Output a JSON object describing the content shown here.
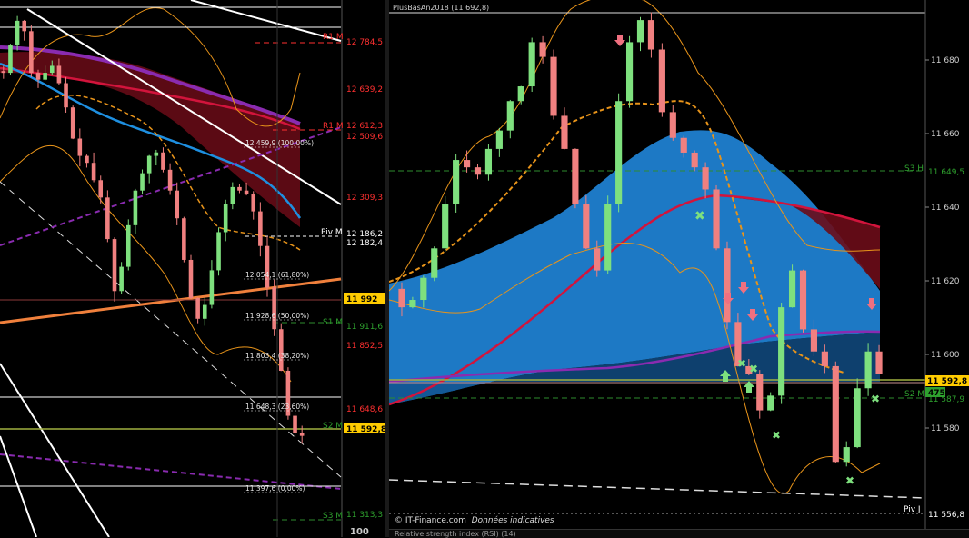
{
  "colors": {
    "background": "#000000",
    "candle_up": "#7ee07e",
    "candle_down": "#f08080",
    "fib_line": "#ffffff",
    "ma_red": "#e0123c",
    "ma_purple": "#9b2bc7",
    "band_blue": "#1e8fe0",
    "band_orange": "#e8941a",
    "trend_orange": "#f0803c",
    "pivot_green": "#2e8b2e",
    "level_red": "#ff2020",
    "price_tag": "#ffcc00"
  },
  "left_chart": {
    "axis_labels": {
      "r1": "R1 M",
      "pivm": "Piv M",
      "s1": "S1 M",
      "s2": "S2 M",
      "s3": "S3 M"
    },
    "price_tags": [
      {
        "text": "12 784,5",
        "color": "red"
      },
      {
        "text": "12 639,2",
        "color": "red"
      },
      {
        "text": "12 612,3",
        "color": "red"
      },
      {
        "text": "12 509,6",
        "color": "red"
      },
      {
        "text": "12 309,3",
        "color": "red"
      },
      {
        "text": "12 186,2",
        "color": "white"
      },
      {
        "text": "12 182,4",
        "color": "white"
      },
      {
        "text": "11 992",
        "color": "yellow"
      },
      {
        "text": "11 911,6",
        "color": "green"
      },
      {
        "text": "11 852,5",
        "color": "red"
      },
      {
        "text": "11 648,6",
        "color": "red"
      },
      {
        "text": "11 592,8",
        "color": "yellow"
      },
      {
        "text": "11 313,3",
        "color": "green"
      }
    ],
    "fib_levels": [
      "12 459,9 (100,00%)",
      "12 054,1 (61,80%)",
      "11 928,6 (50,00%)",
      "11 803,4 (38,20%)",
      "11 648,3 (23,60%)",
      "11 397,6 (0,00%)"
    ],
    "bottom_value": "100"
  },
  "right_chart": {
    "title": "PlusBasAn2018 (11 692,8)",
    "y_ticks": [
      "11 680",
      "11 660",
      "11 640",
      "11 620",
      "11 600",
      "11 580"
    ],
    "level_tags": [
      {
        "label": "S3 H",
        "value": "11 649,5"
      },
      {
        "label": "S2 M",
        "value": "11 587,9"
      },
      {
        "label": "Piv J",
        "value": "11 556,8"
      }
    ],
    "current_price": "11 592,8",
    "extra_tag": "475",
    "footer": "© IT-Finance.com",
    "footer_italic": "Données indicatives",
    "rsi_label": "Relative strength index (RSI) (14)"
  },
  "chart_data": [
    {
      "type": "line",
      "title": "",
      "xlabel": "",
      "ylabel": "",
      "ylim": [
        11300,
        12850
      ],
      "series": [
        {
          "values": [
            12640,
            12720,
            12790,
            12760,
            12640,
            12620,
            12640,
            12660,
            12610,
            12540,
            12450,
            12400,
            12380,
            12330,
            12280,
            12160,
            12010,
            12080,
            12200,
            12300,
            12350,
            12400,
            12410,
            12360,
            12300,
            12220,
            12100,
            11990,
            11930,
            11970,
            12070,
            12180,
            12260,
            12310,
            12300,
            12290,
            12240,
            12140,
            12020,
            11900,
            11780,
            11650,
            11600,
            11592
          ]
        }
      ]
    },
    {
      "type": "line",
      "title": "",
      "xlabel": "",
      "ylabel": "",
      "ylim": [
        11556,
        11692
      ],
      "series": [
        {
          "values": [
            11612,
            11614,
            11620,
            11628,
            11640,
            11652,
            11650,
            11648,
            11655,
            11660,
            11668,
            11672,
            11684,
            11680,
            11664,
            11655,
            11640,
            11628,
            11622,
            11640,
            11668,
            11684,
            11690,
            11682,
            11665,
            11658,
            11654,
            11650,
            11644,
            11628,
            11608,
            11596,
            11594,
            11584,
            11588,
            11612,
            11622,
            11606,
            11600,
            11596,
            11570,
            11574,
            11590,
            11600,
            11594
          ]
        }
      ]
    }
  ]
}
